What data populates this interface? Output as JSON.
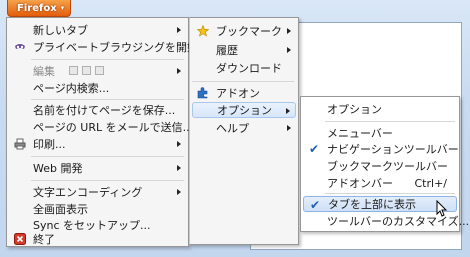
{
  "firefox_button": {
    "label": "Firefox",
    "caret": "▾"
  },
  "main_menu": {
    "new_tab": "新しいタブ",
    "private_browsing": "プライベートブラウジングを開始",
    "edit": "編集",
    "find_in_page": "ページ内検索...",
    "save_page_as": "名前を付けてページを保存...",
    "email_link": "ページの URL をメールで送信...",
    "print": "印刷...",
    "web_developer": "Web 開発",
    "character_encoding": "文字エンコーディング",
    "full_screen": "全画面表示",
    "set_up_sync": "Sync をセットアップ...",
    "exit": "終了"
  },
  "submenu_1": {
    "bookmarks": "ブックマーク",
    "history": "履歴",
    "downloads": "ダウンロード",
    "addons": "アドオン",
    "options": "オプション",
    "help": "ヘルプ"
  },
  "submenu_2": {
    "options": "オプション",
    "menu_bar": "メニューバー",
    "navigation_toolbar": "ナビゲーションツールバー",
    "bookmarks_toolbar": "ブックマークツールバー",
    "addon_bar": "アドオンバー",
    "addon_bar_shortcut": "Ctrl+/",
    "tabs_on_top": "タブを上部に表示",
    "customize_toolbars": "ツールバーのカスタマイズ..."
  },
  "icons": {
    "checkmark_glyph": "✔",
    "firefox_button_color": "#e35d0c",
    "highlight_color": "#d6e6fa"
  }
}
